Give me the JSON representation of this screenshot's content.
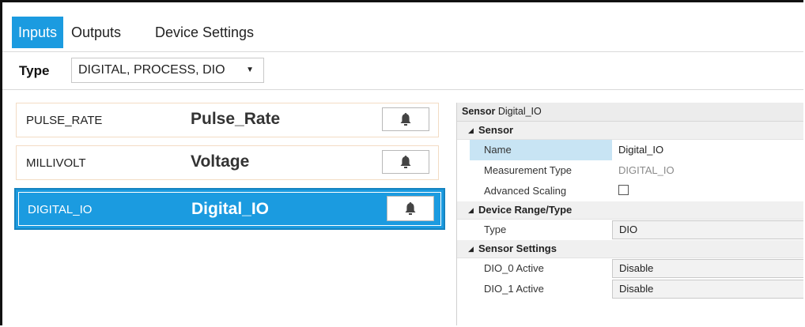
{
  "tabs": [
    {
      "label": "Inputs",
      "active": true
    },
    {
      "label": "Outputs",
      "active": false
    },
    {
      "label": "Device Settings",
      "active": false
    }
  ],
  "type_filter": {
    "label": "Type",
    "selected": "DIGITAL, PROCESS, DIO"
  },
  "sensors": [
    {
      "code": "PULSE_RATE",
      "name": "Pulse_Rate",
      "selected": false
    },
    {
      "code": "MILLIVOLT",
      "name": "Voltage",
      "selected": false
    },
    {
      "code": "DIGITAL_IO",
      "name": "Digital_IO",
      "selected": true
    }
  ],
  "properties": {
    "header_label": "Sensor",
    "header_value": "Digital_IO",
    "categories": [
      {
        "label": "Sensor",
        "rows": [
          {
            "name": "Name",
            "value": "Digital_IO"
          },
          {
            "name": "Measurement Type",
            "value": "DIGITAL_IO"
          },
          {
            "name": "Advanced Scaling",
            "value": "",
            "checked": false
          }
        ]
      },
      {
        "label": "Device Range/Type",
        "rows": [
          {
            "name": "Type",
            "value": "DIO"
          }
        ]
      },
      {
        "label": "Sensor Settings",
        "rows": [
          {
            "name": "DIO_0 Active",
            "value": "Disable"
          },
          {
            "name": "DIO_1 Active",
            "value": "Disable"
          }
        ]
      }
    ]
  },
  "colors": {
    "accent": "#1b9be0",
    "selected_row": "#c8e4f4",
    "card_border": "#f3dcc4"
  },
  "icons": {
    "alarm": "bell-icon",
    "dropdown": "chevron-down-icon",
    "collapse": "collapse-triangle-icon"
  }
}
